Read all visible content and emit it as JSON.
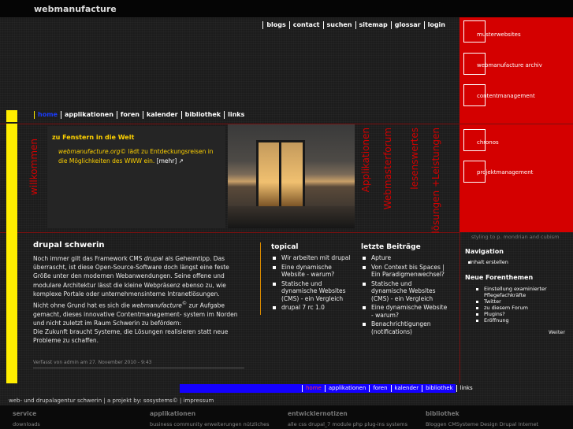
{
  "site": {
    "name": "webmanufacture"
  },
  "top_nav": [
    "blogs",
    "contact",
    "suchen",
    "sitemap",
    "glossar",
    "login"
  ],
  "red_panel": [
    "musterwebsites",
    "webmanufacture archiv",
    "contentmanagement",
    "chronos",
    "projektmanagement"
  ],
  "sub_nav": {
    "items": [
      "home",
      "applikationen",
      "foren",
      "kalender",
      "bibliothek",
      "links"
    ],
    "active": "home"
  },
  "welcome_vertical": "willkommen",
  "feature": {
    "title": "zu Fenstern in die Welt",
    "lead_link": "webmanufacture.org©",
    "lead_text": " lädt zu Entdeckungsreisen in die Möglichkeiten des WWW ein.",
    "more": "[mehr] ↗"
  },
  "vertical_links": [
    "Applikationen",
    "Webmasterforum",
    "lesenswertes",
    "lösungen +Leistungen"
  ],
  "article": {
    "title": "drupal schwerin",
    "p1_a": "Noch immer gilt das Framework CMS ",
    "p1_em": "drupal",
    "p1_b": " als Geheimtipp. Das überrascht, ist diese Open-Source-Software doch längst eine feste Größe unter den modernen Webanwendungen. Seine offene und modulare Architektur lässt die kleine Webpräsenz ebenso zu, wie komplexe Portale oder unternehmensinterne Intranetlösungen.",
    "p2_a": "Nicht ohne Grund hat es sich die ",
    "p2_em": "webmanufacture",
    "p2_sup": "©",
    "p2_b": " zur Aufgabe gemacht, dieses innovative Contentmanagement- system im Norden und nicht zuletzt im Raum Schwerin zu befördern:",
    "p3": "Die Zukunft braucht Systeme, die Lösungen realisieren statt neue Probleme zu schaffen.",
    "meta": "Verfasst von admin am 27. November 2010 - 9:43"
  },
  "topical": {
    "title": "topical",
    "items": [
      "Wir arbeiten mit drupal",
      "Eine dynamische Website - warum?",
      "Statische und dynamische Websites (CMS) - ein Vergleich",
      "drupal 7 rc 1.0"
    ]
  },
  "recent": {
    "title": "letzte Beiträge",
    "items": [
      "Apture",
      "Von Context bis Spaces | Ein Paradigmenwechsel?",
      "Statische und dynamische Websites (CMS) - ein Vergleich",
      "Eine dynamische Website - warum?",
      "Benachrichtigungen (notifications)"
    ]
  },
  "sidebar": {
    "note": "styling to p. mondrian and cubism",
    "nav_title": "Navigation",
    "nav_items": [
      "Inhalt erstellen"
    ],
    "forum_title": "Neue Forenthemen",
    "forum_items": [
      "Einstellung examinierter Pflegefachkräfte",
      "Twitter",
      "zu diesem Forum",
      "Plugins?",
      "Eröffnung"
    ],
    "more": "Weiter"
  },
  "bottom_nav": {
    "items": [
      "home",
      "applikationen",
      "foren",
      "kalender",
      "bibliothek",
      "links"
    ],
    "active": "home"
  },
  "footer": {
    "line": "web- und drupalagentur schwerin | a projekt by: sosystems© | impressum",
    "cols": [
      {
        "title": "service",
        "sub": "downloads"
      },
      {
        "title": "applikationen",
        "sub": "business community erweiterungen nützliches"
      },
      {
        "title": "entwicklernotizen",
        "sub": "alle css drupal_7 module php plug-ins systems"
      },
      {
        "title": "bibliothek",
        "sub": "Bloggen CMSysteme Design Drupal Internet"
      }
    ]
  }
}
